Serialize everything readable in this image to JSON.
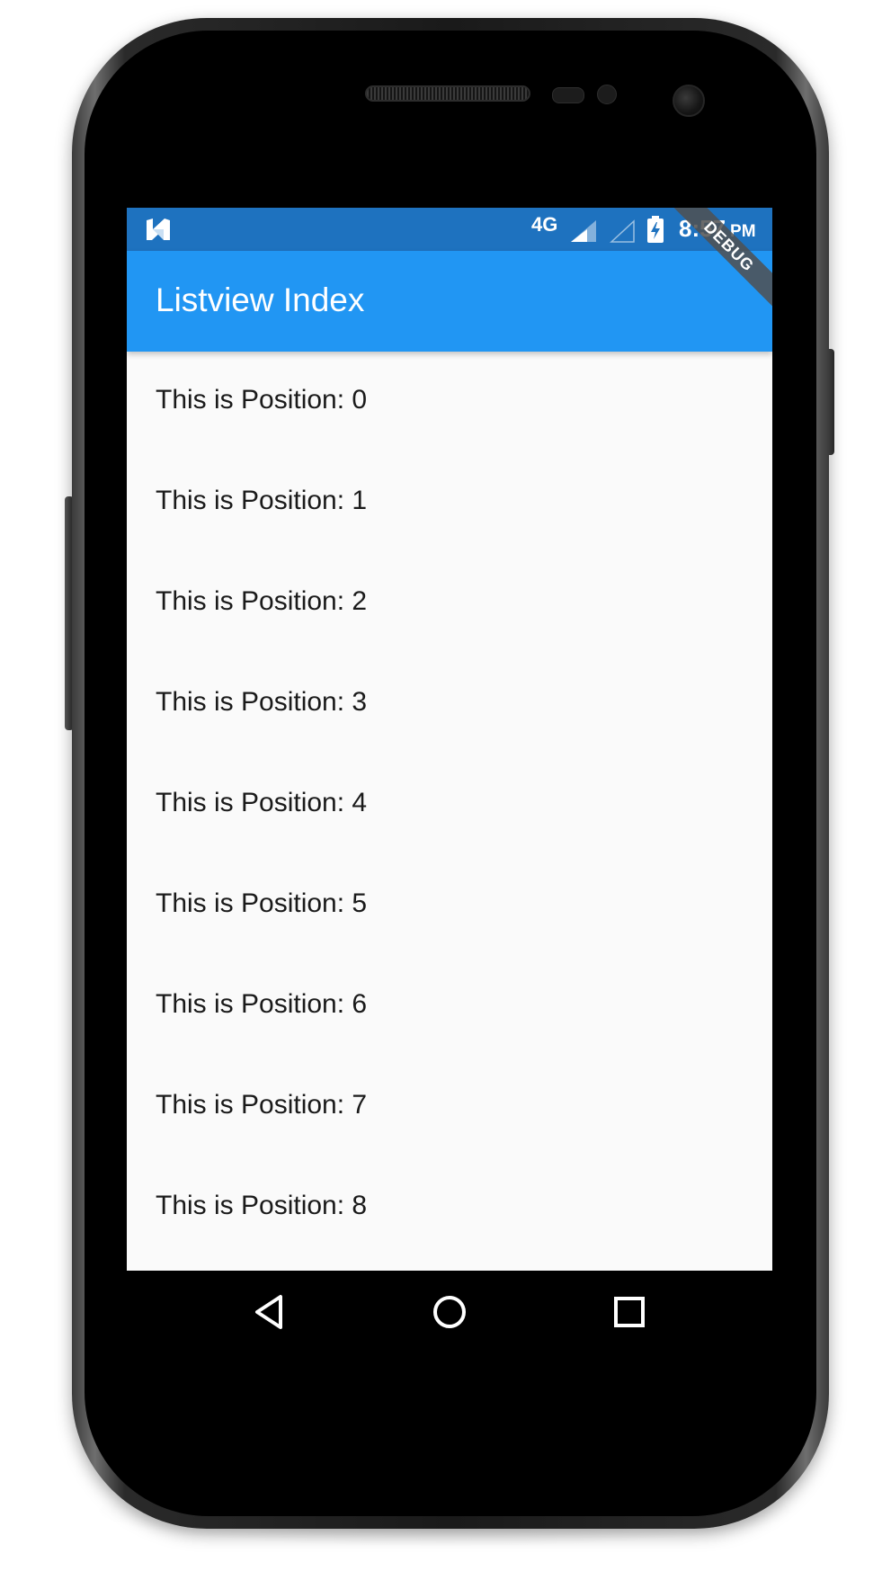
{
  "status_bar": {
    "notification_icon": "n-logo-icon",
    "network": "4G",
    "time": "8:57",
    "am_pm": "PM"
  },
  "debug_banner": "DEBUG",
  "app_bar": {
    "title": "Listview Index",
    "color": "#2196f3"
  },
  "list": {
    "items": [
      "This is Position: 0",
      "This is Position: 1",
      "This is Position: 2",
      "This is Position: 3",
      "This is Position: 4",
      "This is Position: 5",
      "This is Position: 6",
      "This is Position: 7",
      "This is Position: 8"
    ]
  },
  "nav_bar": {
    "back": "back-triangle-icon",
    "home": "home-circle-icon",
    "recents": "recents-square-icon"
  }
}
